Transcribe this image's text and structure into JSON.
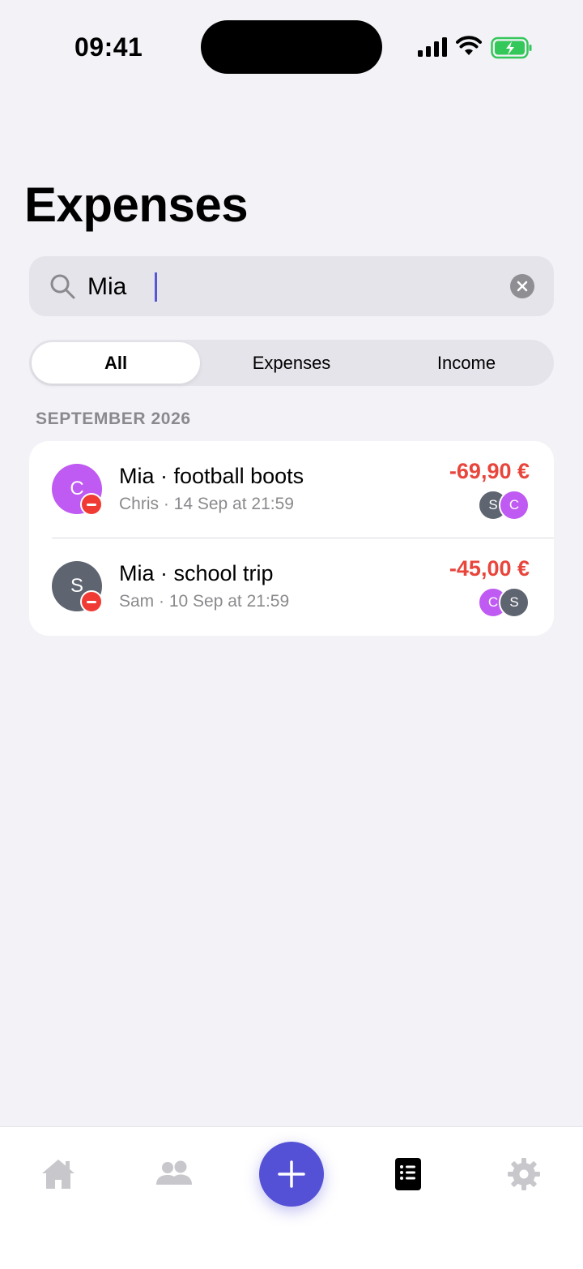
{
  "status_bar": {
    "time": "09:41"
  },
  "page": {
    "title": "Expenses"
  },
  "search": {
    "value": "Mia",
    "clear_icon": "xmark-circle-icon",
    "search_icon": "magnifying-glass-icon"
  },
  "filter": {
    "segments": [
      "All",
      "Expenses",
      "Income"
    ],
    "selected": "All"
  },
  "section": {
    "header": "SEPTEMBER 2026"
  },
  "transactions": [
    {
      "avatar_initial": "C",
      "avatar_color": "#BF5AF2",
      "title": "Mia · football boots",
      "subtitle": "Chris · 14 Sep at 21:59",
      "amount": "-69,90 €",
      "participants": [
        {
          "initial": "S",
          "color": "#5E6470"
        },
        {
          "initial": "C",
          "color": "#BF5AF2"
        }
      ]
    },
    {
      "avatar_initial": "S",
      "avatar_color": "#5E6470",
      "title": "Mia · school trip",
      "subtitle": "Sam · 10 Sep at 21:59",
      "amount": "-45,00 €",
      "participants": [
        {
          "initial": "C",
          "color": "#BF5AF2"
        },
        {
          "initial": "S",
          "color": "#5E6470"
        }
      ]
    }
  ],
  "tab_bar": {
    "items": [
      "house-icon",
      "people-icon",
      "plus-icon",
      "list-icon",
      "gear-icon"
    ],
    "active": "list-icon"
  },
  "colors": {
    "accent": "#5451D6",
    "expense_red": "#E8453C",
    "background": "#F2F2F7"
  }
}
